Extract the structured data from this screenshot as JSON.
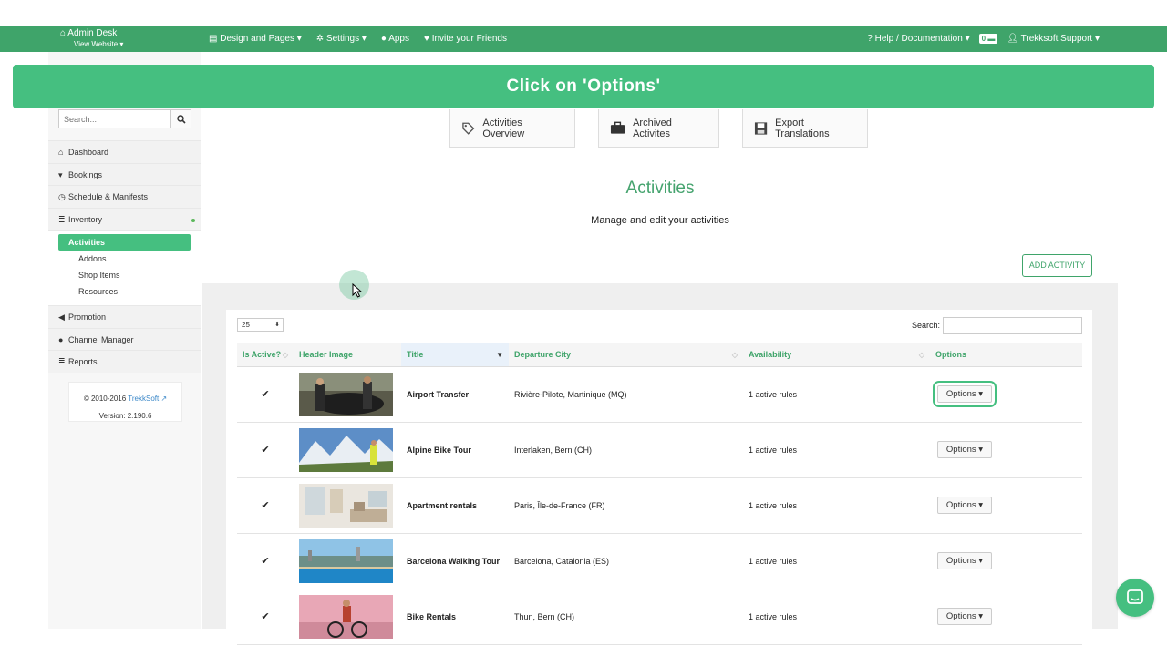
{
  "topbar": {
    "brand_title": "Admin Desk",
    "brand_sub": "View Website",
    "nav": [
      {
        "label": "Design and Pages",
        "icon": "page-icon"
      },
      {
        "label": "Settings",
        "icon": "gear-icon"
      },
      {
        "label": "Apps",
        "icon": "apps-icon"
      },
      {
        "label": "Invite your Friends",
        "icon": "heart-icon"
      }
    ],
    "help_label": "Help / Documentation",
    "badge_count": "0",
    "user_label": "Trekksoft Support",
    "bar_color": "#3fa46a"
  },
  "banner": {
    "text": "Click on 'Options'",
    "color": "#45bf80"
  },
  "sidebar": {
    "search_placeholder": "Search...",
    "menu": [
      {
        "label": "Dashboard",
        "icon": "home-icon"
      },
      {
        "label": "Bookings",
        "icon": "cart-icon"
      },
      {
        "label": "Schedule & Manifests",
        "icon": "clock-icon"
      },
      {
        "label": "Inventory",
        "icon": "list-icon"
      }
    ],
    "submenu": [
      "Activities",
      "Addons",
      "Shop Items",
      "Resources"
    ],
    "menu2": [
      {
        "label": "Promotion",
        "icon": "megaphone-icon"
      },
      {
        "label": "Channel Manager",
        "icon": "globe-icon"
      },
      {
        "label": "Reports",
        "icon": "list-icon"
      }
    ],
    "footer": {
      "copyright": "© 2010-2016",
      "brand": "TrekkSoft",
      "version": "Version: 2.190.6"
    }
  },
  "main": {
    "tabs": [
      "Activities Overview",
      "Archived Activites",
      "Export Translations"
    ],
    "title": "Activities",
    "subtitle": "Manage and edit your activities",
    "add_button": "ADD ACTIVITY",
    "page_length": "25",
    "search_label": "Search:",
    "columns": [
      "Is Active?",
      "Header Image",
      "Title",
      "Departure City",
      "Availability",
      "Options"
    ],
    "rows": [
      {
        "active": "✔",
        "title": "Airport Transfer",
        "city": "Rivière-Pilote, Martinique (MQ)",
        "availability": "1 active rules",
        "options": "Options",
        "image": "car-photo"
      },
      {
        "active": "✔",
        "title": "Alpine Bike Tour",
        "city": "Interlaken, Bern (CH)",
        "availability": "1 active rules",
        "options": "Options",
        "image": "mountain-photo"
      },
      {
        "active": "✔",
        "title": "Apartment rentals",
        "city": "Paris, Île-de-France (FR)",
        "availability": "1 active rules",
        "options": "Options",
        "image": "apartment-photo"
      },
      {
        "active": "✔",
        "title": "Barcelona Walking Tour",
        "city": "Barcelona, Catalonia (ES)",
        "availability": "1 active rules",
        "options": "Options",
        "image": "city-photo"
      },
      {
        "active": "✔",
        "title": "Bike Rentals",
        "city": "Thun, Bern (CH)",
        "availability": "1 active rules",
        "options": "Options",
        "image": "cyclist-photo"
      }
    ]
  }
}
